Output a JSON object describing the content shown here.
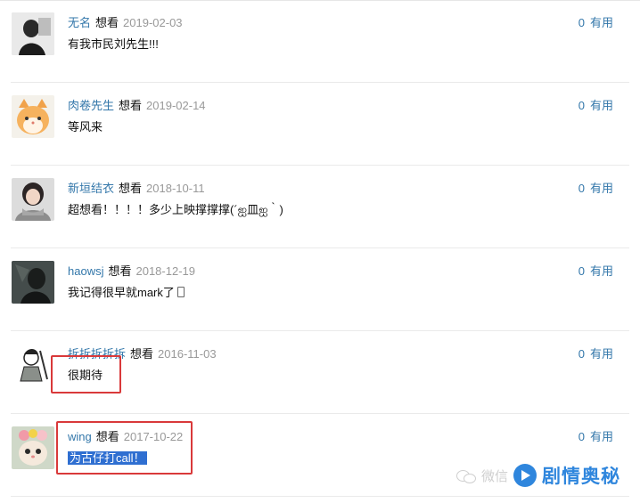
{
  "status_label": "想看",
  "useful_label": "有用",
  "comments": [
    {
      "user": "无名",
      "date": "2019-02-03",
      "text": "有我市民刘先生!!!",
      "votes": "0",
      "avatar_icon": "avatar-dark-portrait"
    },
    {
      "user": "肉卷先生",
      "date": "2019-02-14",
      "text": "等风来",
      "votes": "0",
      "avatar_icon": "avatar-orange-cat"
    },
    {
      "user": "新垣结衣",
      "date": "2018-10-11",
      "text": "超想看！！！！多少上映撑撑撑(´ஐ皿ஐ｀)",
      "votes": "0",
      "avatar_icon": "avatar-girl-scarf"
    },
    {
      "user": "haowsj",
      "date": "2018-12-19",
      "text": "我记得很早就mark了",
      "votes": "0",
      "avatar_icon": "avatar-dark-figure"
    },
    {
      "user": "拆拆拆拆拆",
      "date": "2016-11-03",
      "text": "很期待",
      "votes": "0",
      "avatar_icon": "avatar-cartoon-warrior"
    },
    {
      "user": "wing",
      "date": "2017-10-22",
      "text": "为古仔打call！",
      "votes": "0",
      "avatar_icon": "avatar-cat-flowers"
    }
  ],
  "watermark": {
    "prefix": "微信",
    "title": "剧情奥秘",
    "logo_icon": "play-circle-icon"
  },
  "colors": {
    "link": "#3377aa",
    "date": "#999999",
    "highlight_box": "#d9393a",
    "selection": "#2f6fd1",
    "brand": "#2f86dd"
  }
}
